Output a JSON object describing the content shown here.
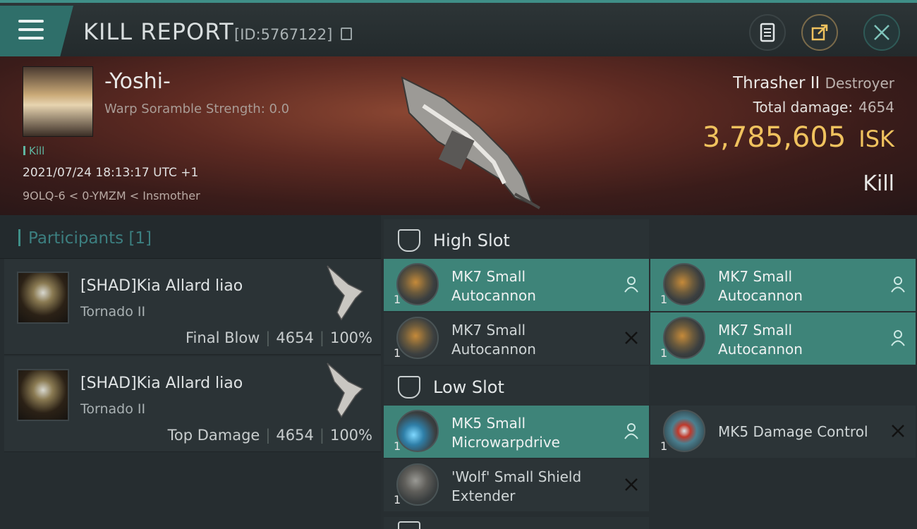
{
  "topbar": {
    "title": "KILL REPORT",
    "kill_id": "[ID:5767122]"
  },
  "victim": {
    "name": "-Yoshi-",
    "warp_scramble": "Warp Soramble Strength: 0.0",
    "tag": "Kill",
    "datetime": "2021/07/24 18:13:17 UTC +1",
    "location": "9OLQ-6 < 0-YMZM < Insmother",
    "ship_name": "Thrasher II",
    "ship_class": "Destroyer",
    "total_damage_label": "Total damage:",
    "total_damage": "4654",
    "isk_value": "3,785,605",
    "isk_unit": "ISK",
    "result": "Kill"
  },
  "participants": {
    "label": "Participants [1]",
    "rows": [
      {
        "name": "[SHAD]Kia Allard liao",
        "ship": "Tornado II",
        "role": "Final Blow",
        "damage": "4654",
        "percent": "100%"
      },
      {
        "name": "[SHAD]Kia Allard liao",
        "ship": "Tornado II",
        "role": "Top Damage",
        "damage": "4654",
        "percent": "100%"
      }
    ]
  },
  "fitting": {
    "high_slot_label": "High Slot",
    "low_slot_label": "Low Slot",
    "high": [
      {
        "name_line1": "MK7 Small",
        "name_line2": "Autocannon",
        "qty": "1",
        "status": "dropped"
      },
      {
        "name_line1": "MK7 Small",
        "name_line2": "Autocannon",
        "qty": "1",
        "status": "dropped"
      },
      {
        "name_line1": "MK7 Small",
        "name_line2": "Autocannon",
        "qty": "1",
        "status": "destroyed"
      },
      {
        "name_line1": "MK7 Small",
        "name_line2": "Autocannon",
        "qty": "1",
        "status": "dropped"
      }
    ],
    "low": [
      {
        "name_line1": "MK5 Small",
        "name_line2": "Microwarpdrive",
        "qty": "1",
        "status": "dropped"
      },
      {
        "name_line1": "MK5 Damage Control",
        "name_line2": "",
        "qty": "1",
        "status": "destroyed"
      },
      {
        "name_line1": "'Wolf' Small Shield",
        "name_line2": "Extender",
        "qty": "1",
        "status": "destroyed"
      }
    ]
  },
  "colors": {
    "accent": "#3f8f88",
    "isk": "#f0c25e",
    "dropped_bg": "#3e8479"
  },
  "icons": [
    "menu-icon",
    "copy-icon",
    "clipboard-icon",
    "share-icon",
    "close-icon",
    "high-slot-icon",
    "low-slot-icon",
    "person-icon",
    "x-icon"
  ]
}
